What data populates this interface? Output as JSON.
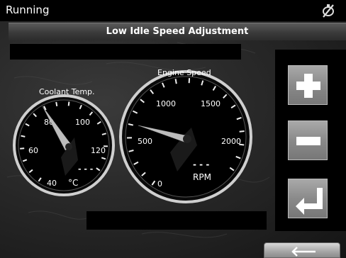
{
  "status": {
    "text": "Running",
    "icon": "no-connection-icon"
  },
  "title": "Low Idle Speed Adjustment",
  "coolant_gauge": {
    "label": "Coolant Temp.",
    "ticks": [
      "40",
      "60",
      "80",
      "100",
      "120"
    ],
    "unit": "°C",
    "readout": "- - -"
  },
  "engine_gauge": {
    "label": "Engine Speed",
    "ticks": [
      "0",
      "500",
      "1000",
      "1500",
      "2000"
    ],
    "unit": "RPM",
    "readout": "- - -"
  },
  "controls": {
    "increase_icon": "plus-icon",
    "decrease_icon": "minus-icon",
    "enter_icon": "enter-icon",
    "back_icon": "back-arrow-icon"
  }
}
